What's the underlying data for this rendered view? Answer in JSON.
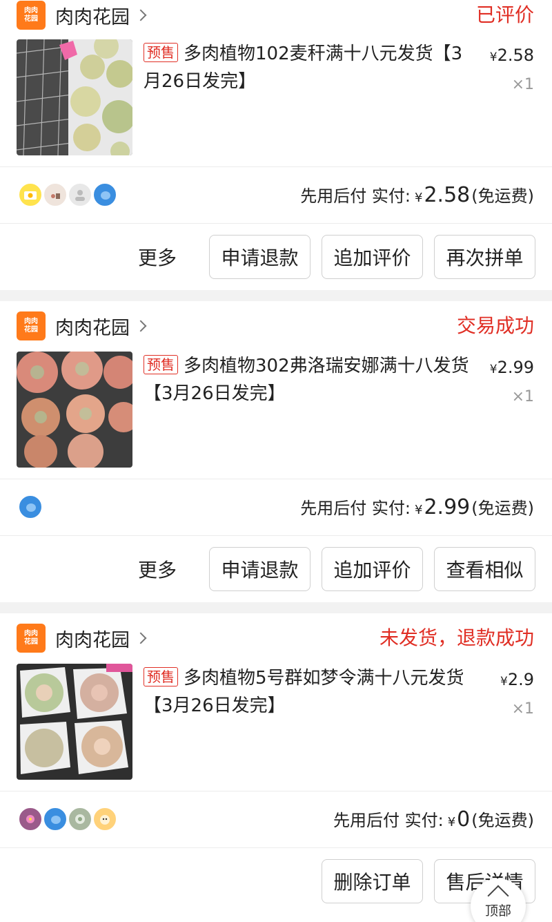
{
  "orders": [
    {
      "shop_logo": [
        "肉肉",
        "花园"
      ],
      "shop_name": "肉肉花园",
      "status": "已评价",
      "tag": "预售",
      "title": "多肉植物102麦秆满十八元发货【3月26日发完】",
      "price_symbol": "¥",
      "price": "2.58",
      "qty": "×1",
      "paid_prefix": "先用后付 实付:",
      "paid_symbol": "¥",
      "paid_amount": "2.58",
      "paid_suffix": "(免运费)",
      "more": "更多",
      "buttons": [
        "申请退款",
        "追加评价",
        "再次拼单"
      ]
    },
    {
      "shop_logo": [
        "肉肉",
        "花园"
      ],
      "shop_name": "肉肉花园",
      "status": "交易成功",
      "tag": "预售",
      "title": "多肉植物302弗洛瑞安娜满十八发货【3月26日发完】",
      "price_symbol": "¥",
      "price": "2.99",
      "qty": "×1",
      "paid_prefix": "先用后付 实付:",
      "paid_symbol": "¥",
      "paid_amount": "2.99",
      "paid_suffix": "(免运费)",
      "more": "更多",
      "buttons": [
        "申请退款",
        "追加评价",
        "查看相似"
      ]
    },
    {
      "shop_logo": [
        "肉肉",
        "花园"
      ],
      "shop_name": "肉肉花园",
      "status": "未发货，退款成功",
      "tag": "预售",
      "title": "多肉植物5号群如梦令满十八元发货【3月26日发完】",
      "price_symbol": "¥",
      "price": "2.9",
      "qty": "×1",
      "paid_prefix": "先用后付 实付:",
      "paid_symbol": "¥",
      "paid_amount": "0",
      "paid_suffix": "(免运费)",
      "buttons": [
        "删除订单",
        "售后详情"
      ]
    }
  ],
  "back_to_top": "顶部",
  "colors": {
    "accent": "#e02e24",
    "shop_logo": "#ff7a1a"
  }
}
